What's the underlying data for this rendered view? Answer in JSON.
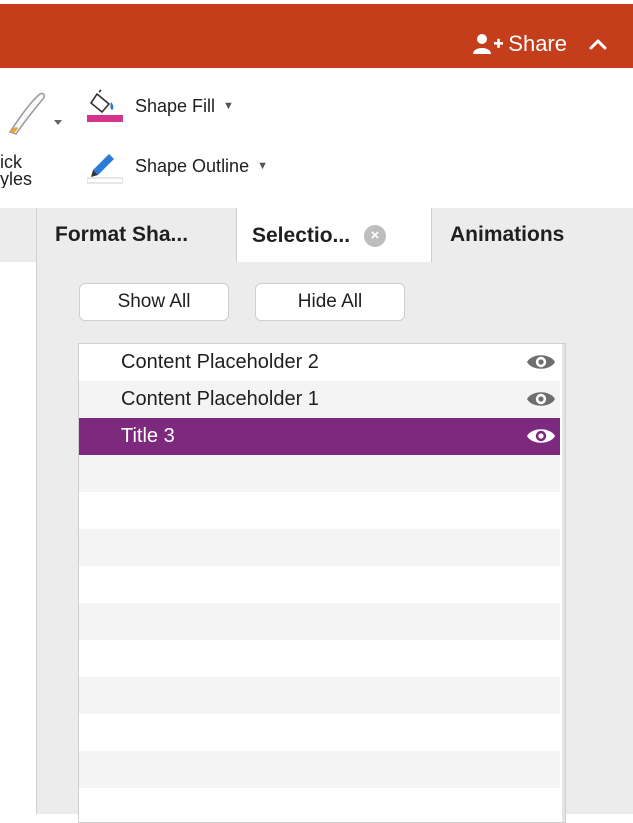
{
  "titlebar": {
    "share_label": "Share",
    "bg_color": "#c43e1c",
    "share_icon": "add-person-icon",
    "collapse_icon": "chevron-up-icon"
  },
  "ribbon": {
    "quick_styles_label_line1": "ick",
    "quick_styles_label_line2": "yles",
    "shape_fill_label": "Shape Fill",
    "shape_outline_label": "Shape Outline",
    "shape_fill_color": "#d6338a"
  },
  "tabs": [
    {
      "label": "Format Sha..."
    },
    {
      "label": "Selectio..."
    },
    {
      "label": "Animations"
    }
  ],
  "selection_pane": {
    "show_all_label": "Show All",
    "hide_all_label": "Hide All",
    "items": [
      {
        "label": "Content Placeholder 2",
        "visible": true
      },
      {
        "label": "Content Placeholder 1",
        "visible": true
      },
      {
        "label": "Title 3",
        "visible": true,
        "selected": true
      }
    ],
    "selected_color": "#7d2a7e"
  }
}
